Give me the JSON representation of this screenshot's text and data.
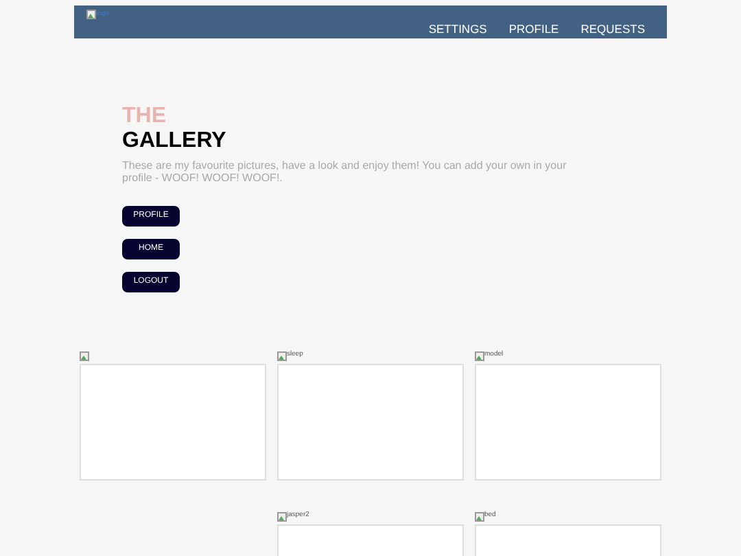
{
  "navbar": {
    "logo_alt": "logo",
    "links": [
      "SETTINGS",
      "PROFILE",
      "REQUESTS"
    ]
  },
  "hero": {
    "title_top": "THE",
    "title_bottom": "GALLERY",
    "text": "These are my favourite pictures, have a look and enjoy them! You can add your own in your profile - WOOF! WOOF! WOOF!.",
    "buttons": [
      "PROFILE",
      "HOME",
      "LOGOUT"
    ]
  },
  "gallery": [
    {
      "kind": "image"
    },
    {
      "kind": "image",
      "alt": "sleep"
    },
    {
      "kind": "image",
      "alt": "model"
    },
    {
      "kind": "empty"
    },
    {
      "kind": "image",
      "alt": "jasper2"
    },
    {
      "kind": "image",
      "alt": "bed"
    }
  ]
}
